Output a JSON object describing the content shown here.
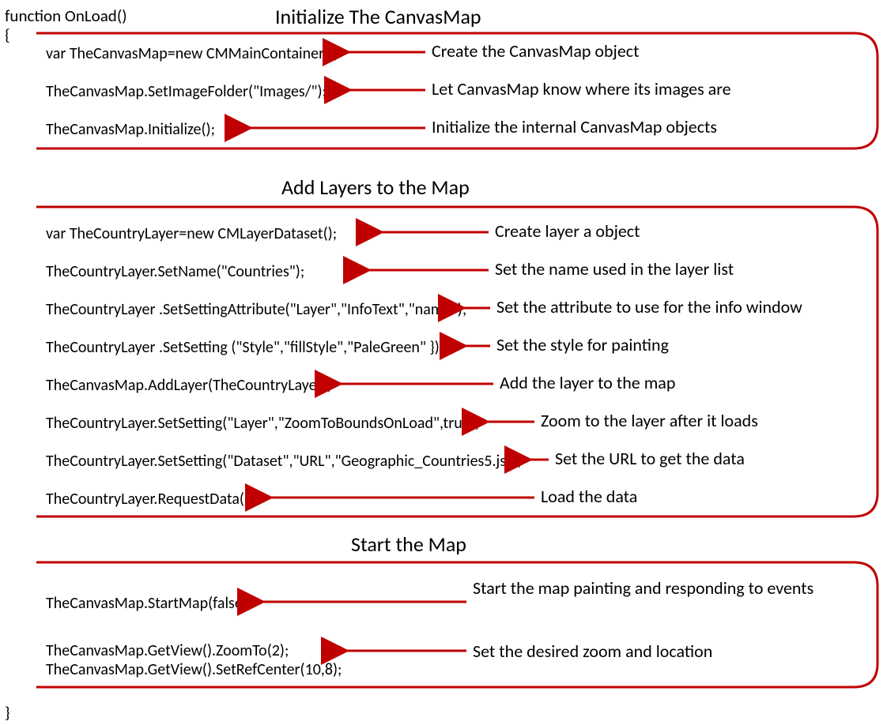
{
  "func": {
    "signature": "function OnLoad()",
    "open": "{",
    "close": "}"
  },
  "sections": {
    "s1": {
      "title": "Initialize The CanvasMap",
      "lines": {
        "l1": "var TheCanvasMap=new CMMainContainer();",
        "l2": "TheCanvasMap.SetImageFolder(\"Images/\");",
        "l3": "TheCanvasMap.Initialize();"
      },
      "annots": {
        "a1": "Create the CanvasMap object",
        "a2": "Let CanvasMap know where its images are",
        "a3": "Initialize the internal CanvasMap objects"
      }
    },
    "s2": {
      "title": "Add Layers to the Map",
      "lines": {
        "l1": "var TheCountryLayer=new CMLayerDataset();",
        "l2": "TheCountryLayer.SetName(\"Countries\");",
        "l3": "TheCountryLayer .SetSettingAttribute(\"Layer\",\"InfoText\",\"name\");",
        "l4": "TheCountryLayer .SetSetting (\"Style\",\"fillStyle\",\"PaleGreen\" });",
        "l5": "TheCanvasMap.AddLayer(TheCountryLayer);",
        "l6": "TheCountryLayer.SetSetting(\"Layer\",\"ZoomToBoundsOnLoad\",true);",
        "l7": "TheCountryLayer.SetSetting(\"Dataset\",\"URL\",\"Geographic_Countries5.js\");",
        "l8": "TheCountryLayer.RequestData();"
      },
      "annots": {
        "a1": "Create layer a object",
        "a2": "Set the name used in the layer list",
        "a3": "Set the attribute to use for the info window",
        "a4": "Set the style for painting",
        "a5": "Add the layer to the map",
        "a6": "Zoom to the layer after it loads",
        "a7": "Set the URL to get the data",
        "a8": "Load the data"
      }
    },
    "s3": {
      "title": "Start the Map",
      "lines": {
        "l1": "TheCanvasMap.StartMap(false);",
        "l2": "TheCanvasMap.GetView().ZoomTo(2);",
        "l3": "TheCanvasMap.GetView().SetRefCenter(10,8);"
      },
      "annots": {
        "a1": "Start the map painting and responding to events",
        "a2": "Set the desired zoom and location"
      }
    }
  }
}
